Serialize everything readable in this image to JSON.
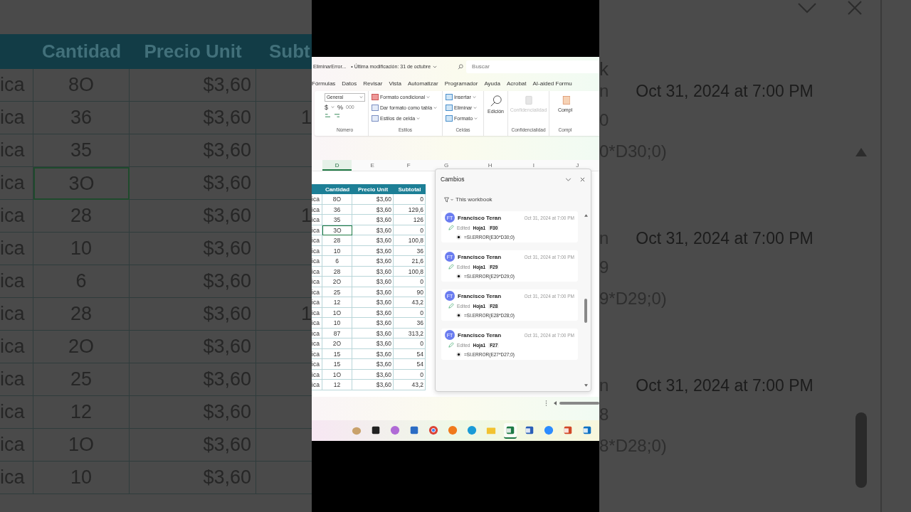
{
  "backdrop_left": {
    "headers": [
      "Cantidad",
      "Precio Unit",
      "Subt"
    ],
    "rows": [
      {
        "product": "ica",
        "quantity": "8O",
        "price": "$3,60",
        "subtotal": "",
        "selected": false
      },
      {
        "product": "ica",
        "quantity": "36",
        "price": "$3,60",
        "subtotal": "1",
        "selected": false
      },
      {
        "product": "ica",
        "quantity": "35",
        "price": "$3,60",
        "subtotal": "",
        "selected": false
      },
      {
        "product": "ica",
        "quantity": "3O",
        "price": "$3,60",
        "subtotal": "",
        "selected": true
      },
      {
        "product": "ica",
        "quantity": "28",
        "price": "$3,60",
        "subtotal": "1",
        "selected": false
      },
      {
        "product": "ica",
        "quantity": "10",
        "price": "$3,60",
        "subtotal": "",
        "selected": false
      },
      {
        "product": "ica",
        "quantity": "6",
        "price": "$3,60",
        "subtotal": "",
        "selected": false
      },
      {
        "product": "ica",
        "quantity": "28",
        "price": "$3,60",
        "subtotal": "1",
        "selected": false
      },
      {
        "product": "ica",
        "quantity": "2O",
        "price": "$3,60",
        "subtotal": "",
        "selected": false
      },
      {
        "product": "ica",
        "quantity": "25",
        "price": "$3,60",
        "subtotal": "",
        "selected": false
      },
      {
        "product": "ica",
        "quantity": "12",
        "price": "$3,60",
        "subtotal": "",
        "selected": false
      },
      {
        "product": "ica",
        "quantity": "1O",
        "price": "$3,60",
        "subtotal": "",
        "selected": false
      },
      {
        "product": "ica",
        "quantity": "10",
        "price": "$3,60",
        "subtotal": "",
        "selected": false
      }
    ]
  },
  "titlebar": {
    "file": "EliminarError...",
    "modified": "• Última modificación: 31 de octubre",
    "search_placeholder": "Buscar"
  },
  "menu": [
    "Fórmulas",
    "Datos",
    "Revisar",
    "Vista",
    "Automatizar",
    "Programador",
    "Ayuda",
    "Acrobat",
    "AI-aided Formu"
  ],
  "ribbon": {
    "number_format": "General",
    "number_symbols": [
      "$",
      "%",
      "000"
    ],
    "number_label": "Número",
    "styles": [
      "Formato condicional",
      "Dar formato como tabla",
      "Estilos de celda"
    ],
    "styles_label": "Estilos",
    "cells": [
      "Insertar",
      "Eliminar",
      "Formato"
    ],
    "cells_label": "Celdas",
    "editing": "Edición",
    "sensitivity": "Confidencialidad",
    "sensitivity_label": "Confidencialidad",
    "compl": "Compl",
    "compl_label": "Compl"
  },
  "column_headers": [
    {
      "label": "D",
      "selected": true
    },
    {
      "label": "E",
      "selected": false
    },
    {
      "label": "F",
      "selected": false
    },
    {
      "label": "G",
      "selected": false
    },
    {
      "label": "H",
      "selected": false
    },
    {
      "label": "I",
      "selected": false
    },
    {
      "label": "J",
      "selected": false
    }
  ],
  "sheet": {
    "headers": [
      "Cantidad",
      "Precio Unit",
      "Subtotal"
    ],
    "rows": [
      {
        "product": "ica",
        "quantity": "8O",
        "price": "$3,60",
        "subtotal": "0",
        "selected": false
      },
      {
        "product": "ica",
        "quantity": "36",
        "price": "$3,60",
        "subtotal": "129,6",
        "selected": false
      },
      {
        "product": "ica",
        "quantity": "35",
        "price": "$3,60",
        "subtotal": "126",
        "selected": false
      },
      {
        "product": "ica",
        "quantity": "3O",
        "price": "$3,60",
        "subtotal": "0",
        "selected": true
      },
      {
        "product": "ica",
        "quantity": "28",
        "price": "$3,60",
        "subtotal": "100,8",
        "selected": false
      },
      {
        "product": "ica",
        "quantity": "10",
        "price": "$3,60",
        "subtotal": "36",
        "selected": false
      },
      {
        "product": "ica",
        "quantity": "6",
        "price": "$3,60",
        "subtotal": "21,6",
        "selected": false
      },
      {
        "product": "ica",
        "quantity": "28",
        "price": "$3,60",
        "subtotal": "100,8",
        "selected": false
      },
      {
        "product": "ica",
        "quantity": "2O",
        "price": "$3,60",
        "subtotal": "0",
        "selected": false
      },
      {
        "product": "ica",
        "quantity": "25",
        "price": "$3,60",
        "subtotal": "90",
        "selected": false
      },
      {
        "product": "ica",
        "quantity": "12",
        "price": "$3,60",
        "subtotal": "43,2",
        "selected": false
      },
      {
        "product": "ica",
        "quantity": "1O",
        "price": "$3,60",
        "subtotal": "0",
        "selected": false
      },
      {
        "product": "ica",
        "quantity": "10",
        "price": "$3,60",
        "subtotal": "36",
        "selected": false
      },
      {
        "product": "ica",
        "quantity": "87",
        "price": "$3,60",
        "subtotal": "313,2",
        "selected": false
      },
      {
        "product": "ica",
        "quantity": "2O",
        "price": "$3,60",
        "subtotal": "0",
        "selected": false
      },
      {
        "product": "ica",
        "quantity": "15",
        "price": "$3,60",
        "subtotal": "54",
        "selected": false
      },
      {
        "product": "ica",
        "quantity": "15",
        "price": "$3,60",
        "subtotal": "54",
        "selected": false
      },
      {
        "product": "ica",
        "quantity": "1O",
        "price": "$3,60",
        "subtotal": "0",
        "selected": false
      },
      {
        "product": "ica",
        "quantity": "12",
        "price": "$3,60",
        "subtotal": "43,2",
        "selected": false
      }
    ]
  },
  "changes_panel": {
    "title": "Cambios",
    "filter": "This workbook",
    "entries": [
      {
        "initials": "FT",
        "author": "Francisco Teran",
        "time": "Oct 31, 2024 at 7:00 PM",
        "action": "Edited",
        "sheet": "Hoja1",
        "cell": "F30",
        "formula": "=SI.ERROR(E30*D30;0)"
      },
      {
        "initials": "FT",
        "author": "Francisco Teran",
        "time": "Oct 31, 2024 at 7:00 PM",
        "action": "Edited",
        "sheet": "Hoja1",
        "cell": "F29",
        "formula": "=SI.ERROR(E29*D29;0)"
      },
      {
        "initials": "FT",
        "author": "Francisco Teran",
        "time": "Oct 31, 2024 at 7:00 PM",
        "action": "Edited",
        "sheet": "Hoja1",
        "cell": "F28",
        "formula": "=SI.ERROR(E28*D28;0)"
      },
      {
        "initials": "FT",
        "author": "Francisco Teran",
        "time": "Oct 31, 2024 at 7:00 PM",
        "action": "Edited",
        "sheet": "Hoja1",
        "cell": "F27",
        "formula": "=SI.ERROR(E27*D27;0)"
      }
    ]
  },
  "taskbar": [
    {
      "kind": "widget",
      "active": false
    },
    {
      "kind": "terminal",
      "active": false
    },
    {
      "kind": "copilot",
      "active": false
    },
    {
      "kind": "store",
      "active": false
    },
    {
      "kind": "chrome",
      "active": false
    },
    {
      "kind": "firefox",
      "active": false
    },
    {
      "kind": "edge",
      "active": false
    },
    {
      "kind": "folder",
      "active": false
    },
    {
      "kind": "excel",
      "active": true
    },
    {
      "kind": "word",
      "active": false
    },
    {
      "kind": "zoom",
      "active": false
    },
    {
      "kind": "powerpoint",
      "active": false
    },
    {
      "kind": "outlook",
      "active": false
    }
  ],
  "backdrop_right": {
    "filter_fragment": "k",
    "entries": [
      {
        "name_fragment": "n",
        "time": "Oct 31, 2024 at 7:00 PM",
        "cell_fragment": "0",
        "formula_fragment": "0*D30;0)"
      },
      {
        "name_fragment": "n",
        "time": "Oct 31, 2024 at 7:00 PM",
        "cell_fragment": "9",
        "formula_fragment": "9*D29;0)"
      },
      {
        "name_fragment": "n",
        "time": "Oct 31, 2024 at 7:00 PM",
        "cell_fragment": "8",
        "formula_fragment": "8*D28;0)"
      }
    ]
  }
}
